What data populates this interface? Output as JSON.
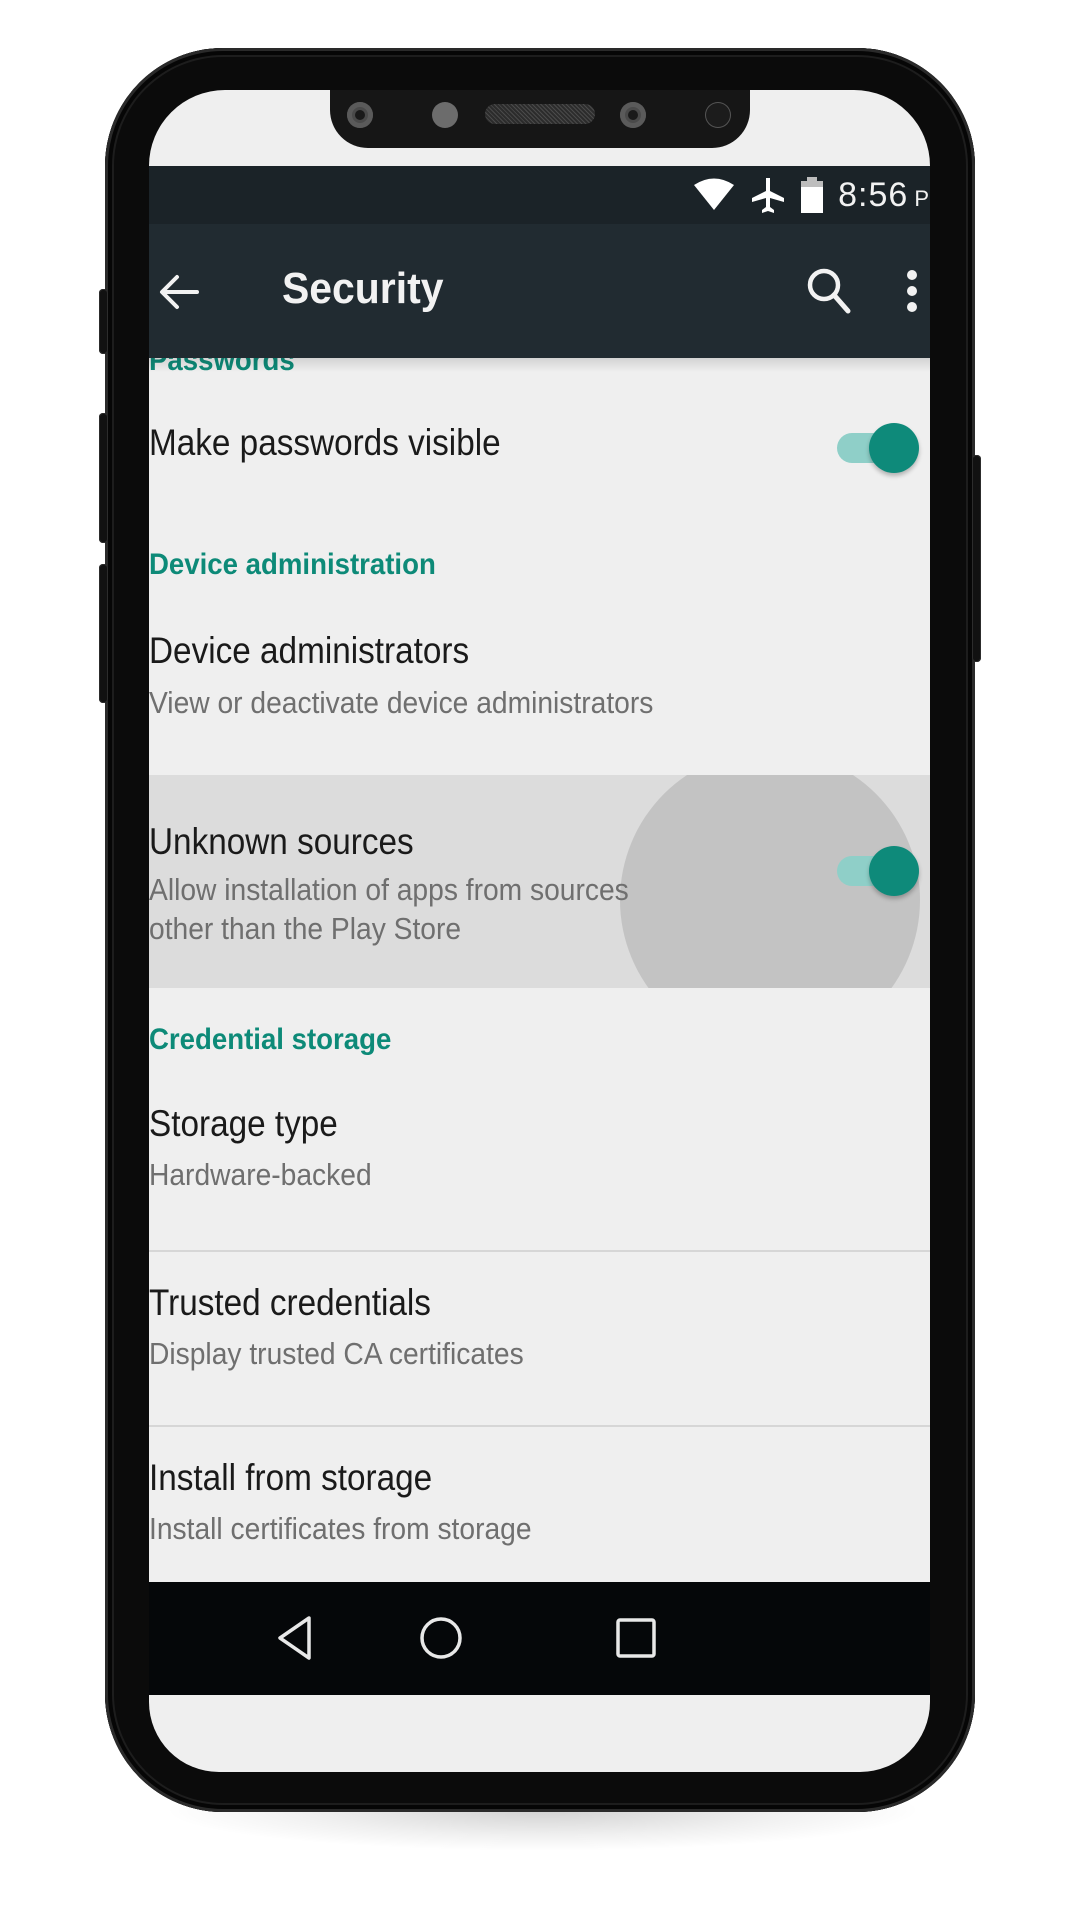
{
  "status_bar": {
    "icons": [
      "wifi-icon",
      "airplane-mode-icon",
      "battery-icon"
    ],
    "time": "8:56",
    "time_suffix": "P"
  },
  "toolbar": {
    "back_icon": "arrow-back-icon",
    "title": "Security",
    "search_icon": "search-icon",
    "more_icon": "more-vert-icon"
  },
  "sections": [
    {
      "header": "Passwords",
      "items": [
        {
          "title": "Make passwords visible",
          "toggle": true
        }
      ]
    },
    {
      "header": "Device administration",
      "items": [
        {
          "title": "Device administrators",
          "summary": "View or deactivate device administrators"
        },
        {
          "title": "Unknown sources",
          "summary_lines": [
            "Allow installation of apps from sources",
            "other than the Play Store"
          ],
          "toggle": true,
          "pressed": true
        }
      ]
    },
    {
      "header": "Credential storage",
      "items": [
        {
          "title": "Storage type",
          "summary": "Hardware-backed"
        },
        {
          "title": "Trusted credentials",
          "summary": "Display trusted CA certificates"
        },
        {
          "title": "Install from storage",
          "summary": "Install certificates from storage"
        }
      ]
    }
  ],
  "nav_bar": {
    "back": "nav-back-icon",
    "home": "nav-home-icon",
    "recents": "nav-recents-icon"
  },
  "colors": {
    "accent": "#0e8a7a",
    "toolbar": "#212b31",
    "status_bar": "#1b2328",
    "background": "#efefef"
  }
}
